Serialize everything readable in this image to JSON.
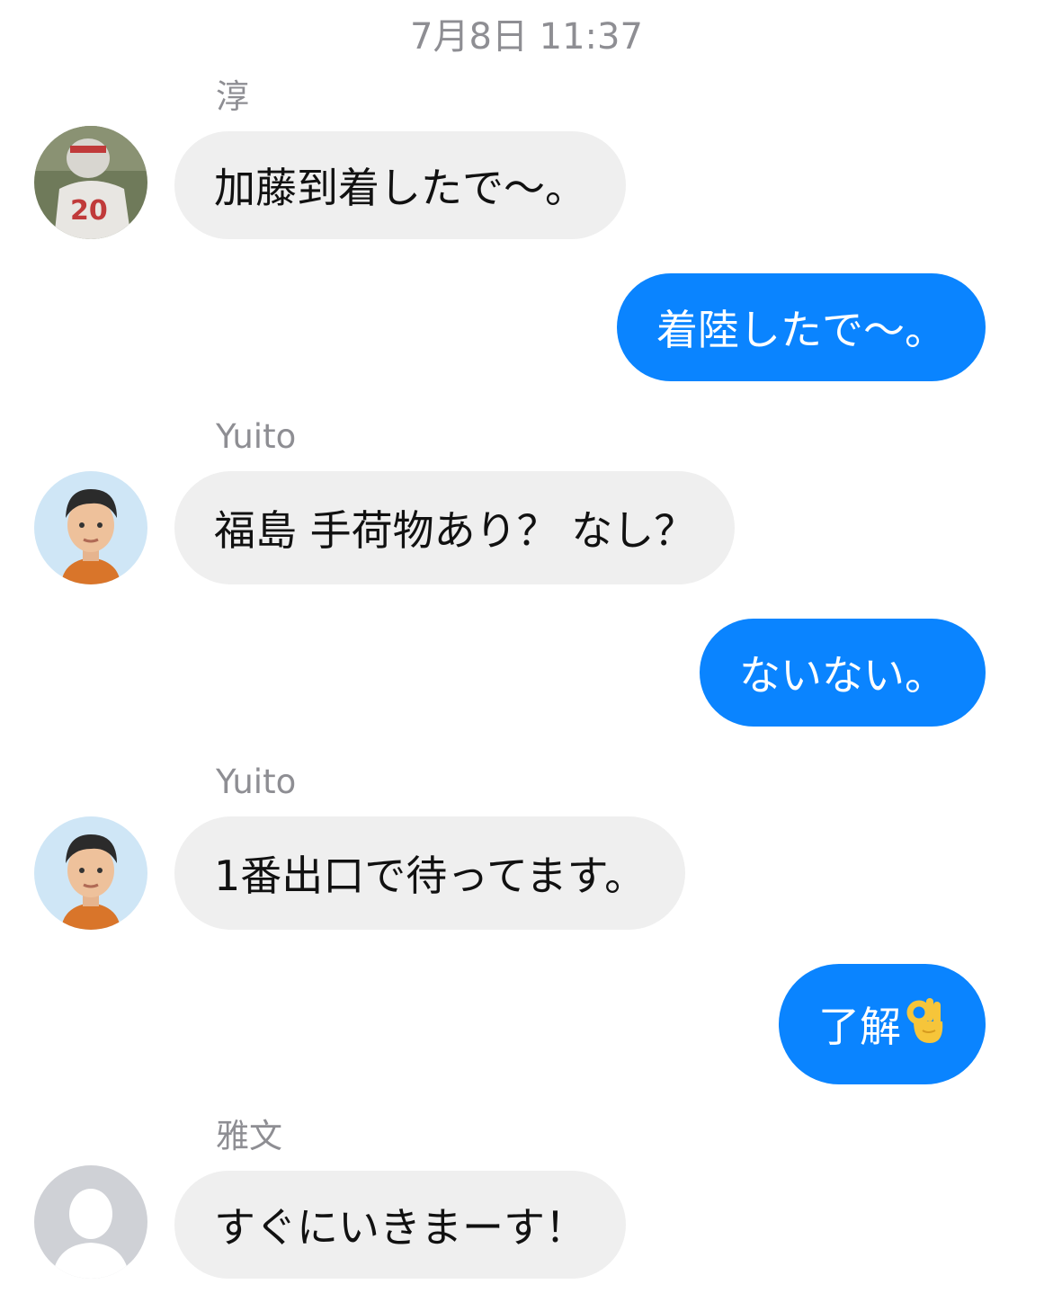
{
  "timestamp": "7月8日 11:37",
  "colors": {
    "outgoing_bubble": "#0a84ff",
    "incoming_bubble": "#efefef",
    "meta_text": "#8e8e93"
  },
  "messages": [
    {
      "sender": "淳",
      "avatar": "football-player-photo",
      "text": "加藤到着したで〜。"
    },
    {
      "sender": "",
      "text": "着陸したで〜。"
    },
    {
      "sender": "Yuito",
      "avatar": "cartoon-man-avatar",
      "text": "福島 手荷物あり？ なし？"
    },
    {
      "sender": "",
      "text": "ないない。"
    },
    {
      "sender": "Yuito",
      "avatar": "cartoon-man-avatar",
      "text": "1番出口で待ってます。"
    },
    {
      "sender": "",
      "text": "了解",
      "emoji": "ok-hand-emoji"
    },
    {
      "sender": "雅文",
      "avatar": "default-user-silhouette",
      "text": "すぐにいきまーす！"
    }
  ]
}
